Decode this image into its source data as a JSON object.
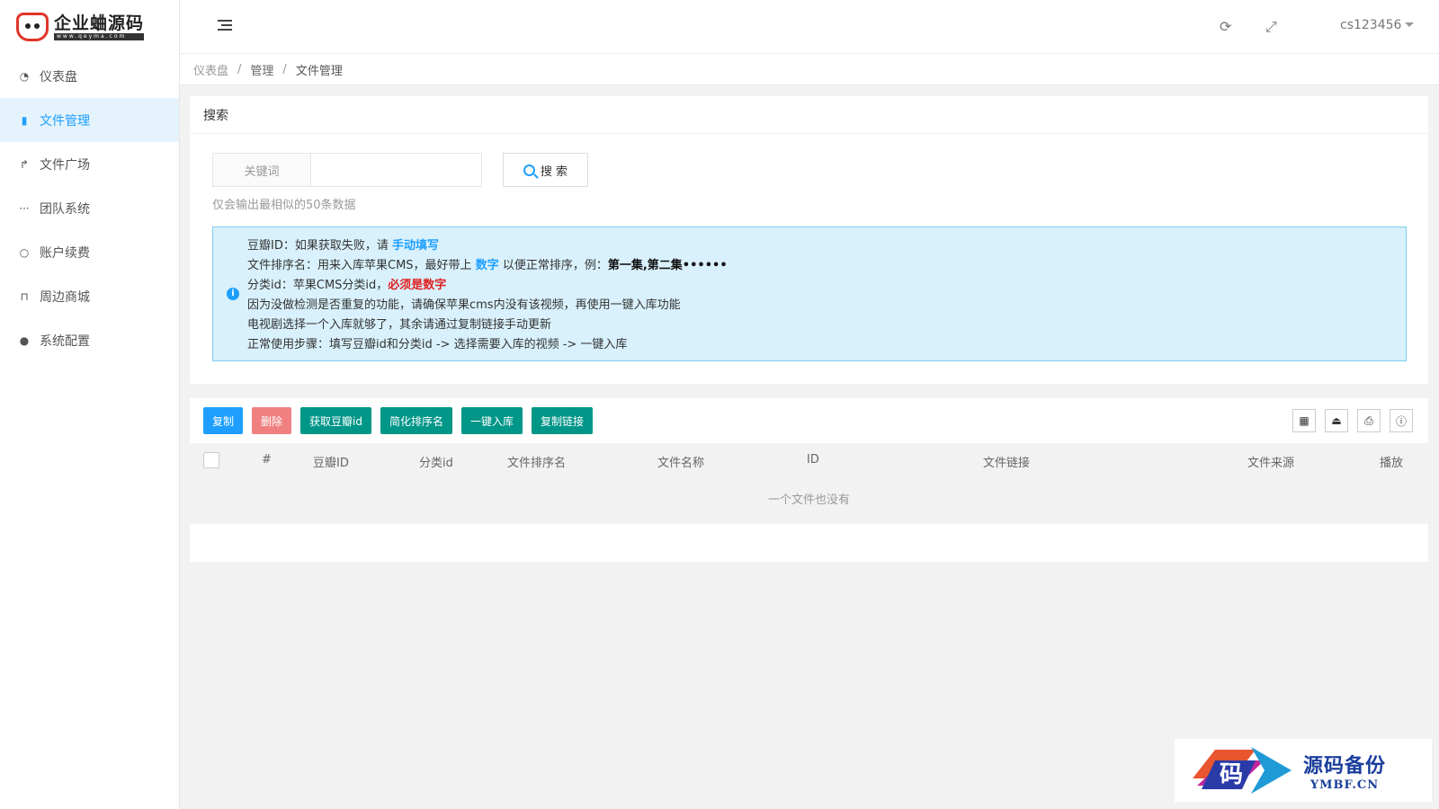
{
  "brand": {
    "title": "企业蛐源码",
    "sub": "www.qeyma.com"
  },
  "sidebar": {
    "items": [
      {
        "label": "仪表盘",
        "icon": "dashboard-icon",
        "active": false
      },
      {
        "label": "文件管理",
        "icon": "file-icon",
        "active": true
      },
      {
        "label": "文件广场",
        "icon": "share-icon",
        "active": false
      },
      {
        "label": "团队系统",
        "icon": "ellipsis-icon",
        "active": false
      },
      {
        "label": "账户续费",
        "icon": "circle-icon",
        "active": false
      },
      {
        "label": "周边商城",
        "icon": "cart-icon",
        "active": false
      },
      {
        "label": "系统配置",
        "icon": "user-icon",
        "active": false
      }
    ]
  },
  "header": {
    "user": "cs123456"
  },
  "breadcrumb": {
    "items": [
      "仪表盘",
      "管理",
      "文件管理"
    ]
  },
  "search": {
    "title": "搜索",
    "keyword_label": "关键词",
    "keyword_value": "",
    "button": "搜 索",
    "hint": "仅会输出最相似的50条数据"
  },
  "notice": {
    "l1a": "豆瓣ID：如果获取失败，请 ",
    "l1b": "手动填写",
    "l2a": "文件排序名：用来入库苹果CMS，最好带上 ",
    "l2b": "数字",
    "l2c": " 以便正常排序，例：",
    "l2d": "第一集,第二集••••••",
    "l3a": "分类id：苹果CMS分类id，",
    "l3b": "必须是数字",
    "l4": "因为没做检测是否重复的功能，请确保苹果cms内没有该视频，再使用一键入库功能",
    "l5": "电视剧选择一个入库就够了，其余请通过复制链接手动更新",
    "l6": "正常使用步骤：填写豆瓣id和分类id -> 选择需要入库的视频 -> 一键入库"
  },
  "toolbar": {
    "copy": "复制",
    "delete": "删除",
    "fetch": "获取豆瓣id",
    "simplify": "简化排序名",
    "import": "一键入库",
    "copy_link": "复制链接"
  },
  "table": {
    "columns": [
      "#",
      "豆瓣ID",
      "分类id",
      "文件排序名",
      "文件名称",
      "ID",
      "文件链接",
      "文件来源",
      "播放"
    ],
    "empty": "一个文件也没有"
  },
  "watermark": {
    "t1": "源码备份",
    "t2": "YMBF.CN",
    "glyph": "码"
  },
  "colors": {
    "accent": "#1e9fff",
    "green": "#009688",
    "danger": "#f08080"
  }
}
